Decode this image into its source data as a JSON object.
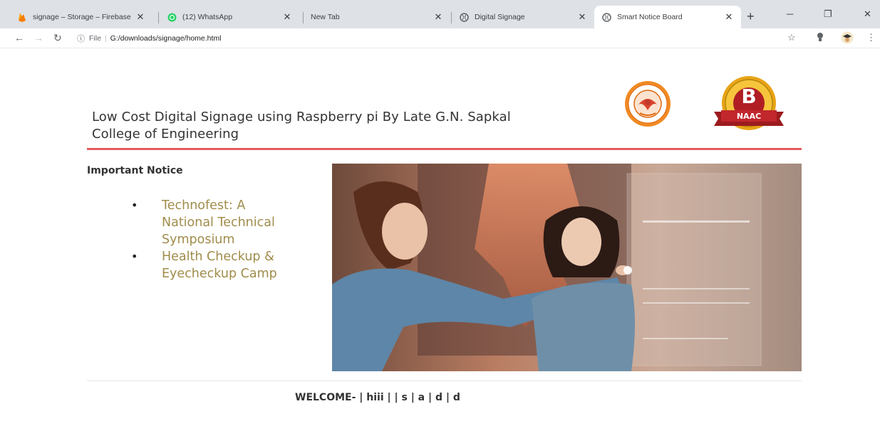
{
  "browser": {
    "tabs": [
      {
        "title": "signage – Storage – Firebase c",
        "icon": "firebase-icon"
      },
      {
        "title": "(12) WhatsApp",
        "icon": "whatsapp-icon"
      },
      {
        "title": "New Tab",
        "icon": "none"
      },
      {
        "title": "Digital Signage",
        "icon": "globe-icon"
      },
      {
        "title": "Smart Notice Board",
        "icon": "globe-icon",
        "active": true
      }
    ],
    "address": {
      "scheme": "File",
      "url": "G:/downloads/signage/home.html"
    }
  },
  "page": {
    "title": "Low Cost Digital Signage using Raspberry pi By Late G.N. Sapkal College of Engineering",
    "logos": {
      "college_seal_icon": "college-seal-icon",
      "naac_badge": {
        "letter": "B",
        "ribbon": "NAAC"
      }
    },
    "notice": {
      "heading": "Important Notice",
      "items": [
        "Technofest: A National Technical Symposium",
        "Health Checkup & Eyecheckup Camp"
      ]
    },
    "welcome_text": "WELCOME- | hiii | | s | a | d | d",
    "colors": {
      "accent_rule": "#e45b5b",
      "notice_text": "#a08c4a"
    }
  }
}
